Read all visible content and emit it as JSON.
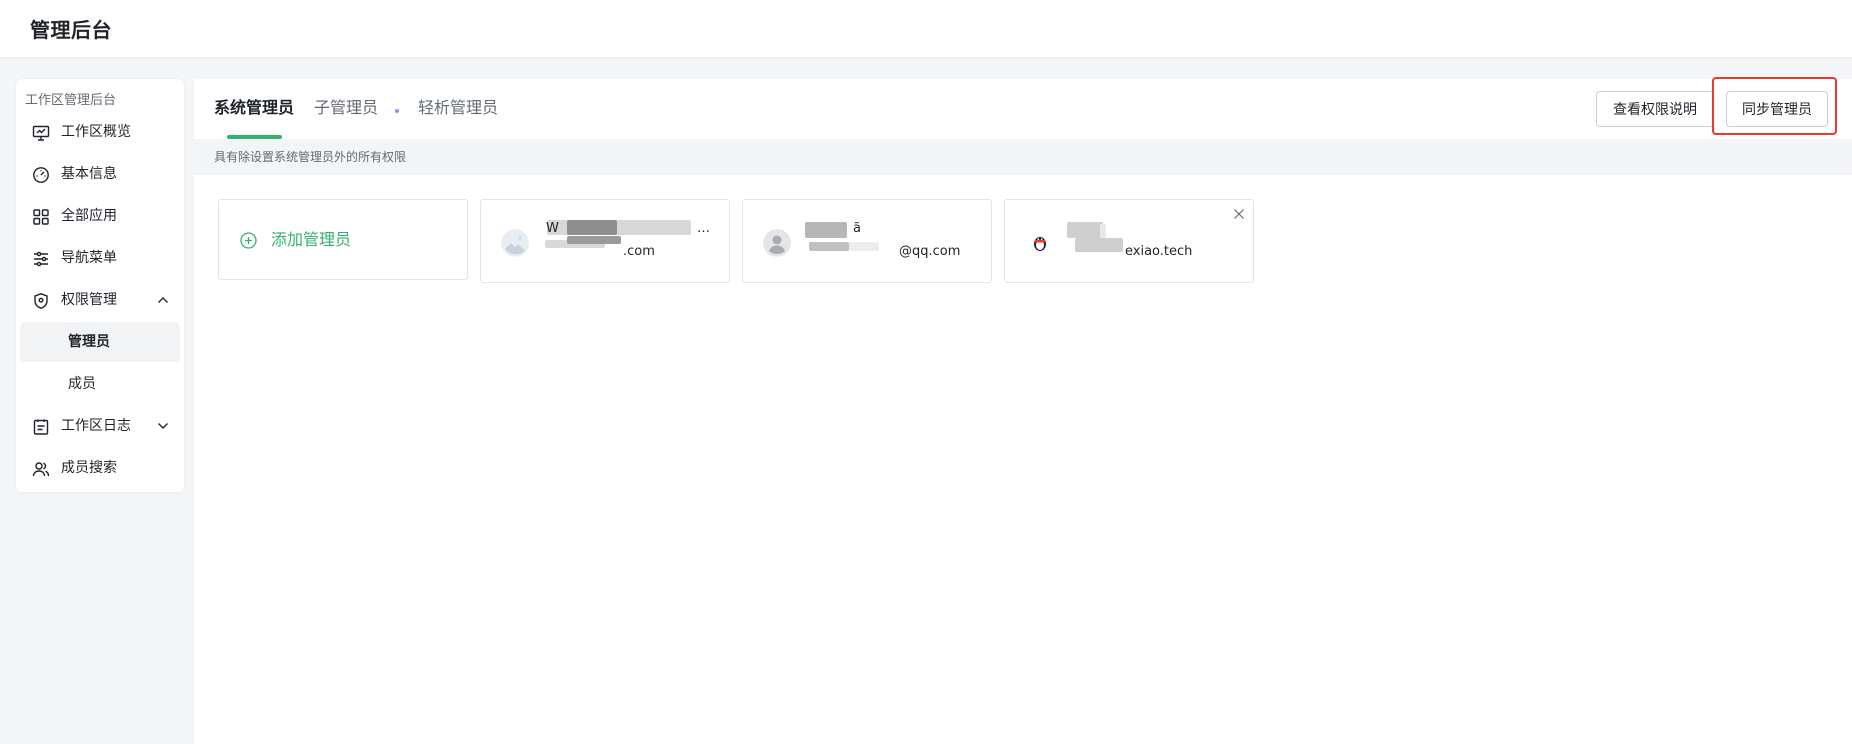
{
  "header": {
    "title": "管理后台"
  },
  "sidebar": {
    "section_title": "工作区管理后台",
    "items": [
      {
        "label": "工作区概览",
        "icon": "monitor-icon"
      },
      {
        "label": "基本信息",
        "icon": "gauge-icon"
      },
      {
        "label": "全部应用",
        "icon": "grid-icon"
      },
      {
        "label": "导航菜单",
        "icon": "sliders-icon"
      },
      {
        "label": "权限管理",
        "icon": "shield-icon",
        "expanded": true,
        "children": [
          {
            "label": "管理员",
            "active": true
          },
          {
            "label": "成员"
          }
        ]
      },
      {
        "label": "工作区日志",
        "icon": "clipboard-icon",
        "expanded": false
      },
      {
        "label": "成员搜索",
        "icon": "users-icon"
      }
    ]
  },
  "tabs": [
    {
      "label": "系统管理员",
      "active": true
    },
    {
      "label": "子管理员"
    },
    {
      "label": "轻析管理员"
    }
  ],
  "actions": {
    "view_permissions_label": "查看权限说明",
    "sync_admin_label": "同步管理员"
  },
  "description": "具有除设置系统管理员外的所有权限",
  "add_admin_label": "添加管理员",
  "admins": [
    {
      "name_visible": "W",
      "name_suffix": "…",
      "email_visible": ".com"
    },
    {
      "name_visible": " ",
      "name_suffix": "ã",
      "email_visible": "@qq.com"
    },
    {
      "name_visible": " ",
      "name_suffix": "",
      "email_visible": "exiao.tech",
      "removable": true
    }
  ],
  "colors": {
    "accent": "#34b26b",
    "highlight": "#e53b2c"
  }
}
